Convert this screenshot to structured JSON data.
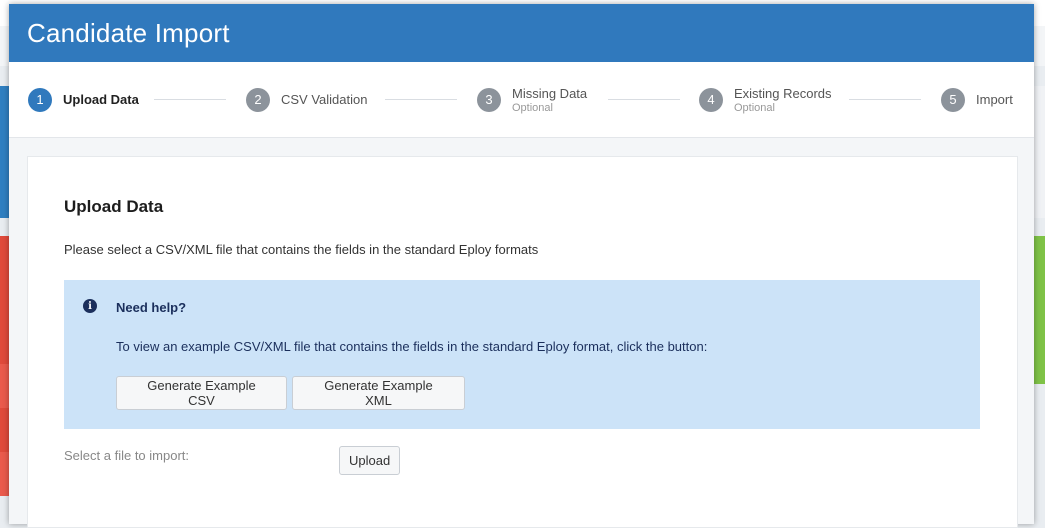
{
  "modal": {
    "title": "Candidate Import"
  },
  "stepper": {
    "steps": [
      {
        "number": "1",
        "label": "Upload Data",
        "sub": "",
        "active": true
      },
      {
        "number": "2",
        "label": "CSV Validation",
        "sub": "",
        "active": false
      },
      {
        "number": "3",
        "label": "Missing Data",
        "sub": "Optional",
        "active": false
      },
      {
        "number": "4",
        "label": "Existing Records",
        "sub": "Optional",
        "active": false
      },
      {
        "number": "5",
        "label": "Import",
        "sub": "",
        "active": false
      }
    ]
  },
  "upload": {
    "title": "Upload Data",
    "description": "Please select a CSV/XML file that contains the fields in the standard Eploy formats",
    "help": {
      "icon": "info-icon",
      "title": "Need help?",
      "text": "To view an example CSV/XML file that contains the fields in the standard Eploy format, click the button:",
      "csv_button": "Generate Example CSV",
      "xml_button": "Generate Example XML"
    },
    "file_label": "Select a file to import:",
    "upload_button": "Upload"
  },
  "colors": {
    "header_bg": "#3079bd",
    "active_step": "#3079bd",
    "inactive_step": "#8c939b",
    "help_bg": "#cce3f8",
    "help_text": "#1b2f5c"
  }
}
